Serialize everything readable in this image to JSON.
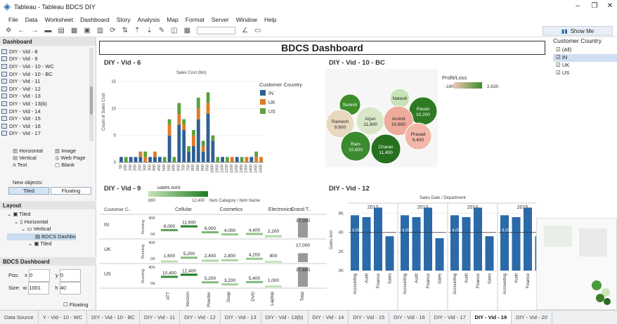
{
  "window": {
    "title": "Tableau - Tableau BDCS DIY"
  },
  "menu": [
    "File",
    "Data",
    "Worksheet",
    "Dashboard",
    "Story",
    "Analysis",
    "Map",
    "Format",
    "Server",
    "Window",
    "Help"
  ],
  "toolbar": {
    "show_me": "Show Me"
  },
  "left": {
    "dashboard_header": "Dashboard",
    "sheets": [
      "DIY - Vid - 8",
      "DIY - Vid - 9",
      "DIY - Vid - 10 - WC",
      "DIY - Vid - 10 - BC",
      "DIY - Vid - 11",
      "DIY - Vid - 12",
      "DIY - Vid - 13",
      "DIY - Vid - 13(b)",
      "DIY - Vid - 14",
      "DIY - Vid - 15",
      "DIY - Vid - 16",
      "DIY - Vid - 17"
    ],
    "objects": [
      "Horizontal",
      "Image",
      "Vertical",
      "Web Page",
      "Text",
      "Blank"
    ],
    "new_objects": "New objects:",
    "tiled": "Tiled",
    "floating": "Floating",
    "layout_header": "Layout",
    "tree": [
      "Tiled",
      "Horizontal",
      "Vertical",
      "BDCS Dashbo",
      "Tiled"
    ],
    "bdcs_header": "BDCS Dashboard",
    "pos_label": "Pos:",
    "size_label": "Size:",
    "x": "0",
    "y": "0",
    "w": "1001",
    "h": "40",
    "floating_check": "Floating"
  },
  "dashboard": {
    "title": "BDCS Dashboard",
    "sheet6": "DIY - Vid - 6",
    "sheet10": "DIY - Vid - 10 - BC",
    "sheet9": "DIY - Vid - 9",
    "sheet12": "DIY - Vid - 12"
  },
  "filter": {
    "title": "Customer Country",
    "options": [
      "(All)",
      "IN",
      "UK",
      "US"
    ]
  },
  "tabs": [
    "Data Source",
    "Y - Vid - 10 - WC",
    "DIY - Vid - 10 - BC",
    "DIY - Vid - 11",
    "DIY - Vid - 12",
    "DIY - Vid - 13",
    "DIY - Vid - 13(b)",
    "DIY - Vid - 14",
    "DIY - Vid - 15",
    "DIY - Vid - 16",
    "DIY - Vid - 17",
    "DIY - Vid - 19",
    "DIY - Vid - 20"
  ],
  "colors": {
    "IN": "#2e5f94",
    "UK": "#e07b25",
    "US": "#5aa33a",
    "green": "#2f8a2a",
    "blue": "#2a6aa8"
  },
  "chart_data": [
    {
      "type": "bar",
      "title": "Sales Cost (bin)",
      "ylabel": "Count of Sales Cost",
      "ylim": [
        0,
        15
      ],
      "categories": [
        "50",
        "100",
        "150",
        "200",
        "250",
        "300",
        "350",
        "400",
        "450",
        "500",
        "550",
        "600",
        "650",
        "700",
        "750",
        "800",
        "850",
        "900",
        "950",
        "1000",
        "1050",
        "1100",
        "1150",
        "1200",
        "1250",
        "1300",
        "1350",
        "1400",
        "1450",
        "1500"
      ],
      "series": [
        {
          "name": "IN",
          "values": [
            1,
            0,
            1,
            1,
            1,
            0,
            1,
            1,
            1,
            0,
            5,
            0,
            7,
            6,
            2,
            3,
            8,
            2,
            9,
            4,
            0,
            1,
            0,
            0,
            1,
            0,
            0,
            1,
            0,
            0
          ]
        },
        {
          "name": "UK",
          "values": [
            0,
            0,
            0,
            0,
            1,
            1,
            0,
            1,
            0,
            0,
            2,
            0,
            2,
            1,
            0,
            2,
            2,
            1,
            2,
            0,
            0,
            0,
            0,
            1,
            0,
            0,
            1,
            0,
            1,
            1
          ]
        },
        {
          "name": "US",
          "values": [
            0,
            1,
            0,
            0,
            0,
            1,
            0,
            0,
            0,
            1,
            1,
            1,
            2,
            1,
            1,
            1,
            2,
            1,
            2,
            1,
            1,
            0,
            1,
            0,
            0,
            1,
            0,
            0,
            1,
            0
          ]
        }
      ],
      "legend_title": "Customer Country"
    },
    {
      "type": "scatter",
      "title": "Profit/Loss",
      "legend_range": [
        "-180",
        "2,630"
      ],
      "bubbles": [
        {
          "name": "Suresh",
          "value": ""
        },
        {
          "name": "Naresh",
          "value": ""
        },
        {
          "name": "Pavan",
          "value": "10,200"
        },
        {
          "name": "Ramesh",
          "value": "9,600"
        },
        {
          "name": "Arjun",
          "value": "11,800"
        },
        {
          "name": "Arvind",
          "value": "10,600"
        },
        {
          "name": "Prasad",
          "value": "9,400"
        },
        {
          "name": "Ram",
          "value": "10,600"
        },
        {
          "name": "Charan",
          "value": "11,400"
        }
      ]
    },
    {
      "type": "table",
      "title": "Sales Amt",
      "legend_range": [
        "880",
        "12,400"
      ],
      "header": "Item Category / Item Name",
      "row_header": "Customer C..",
      "categories": [
        "Cellular",
        "Cosmetics",
        "Electronics",
        "Grand T.."
      ],
      "items": [
        "ATT",
        "Verizon",
        "Powder",
        "Soap",
        "DVD",
        "Laptop",
        "Total"
      ],
      "rows": [
        {
          "country": "IN",
          "values": [
            "8,000",
            "11,600",
            "6,000",
            "4,000",
            "4,400",
            "2,200",
            "37,000"
          ]
        },
        {
          "country": "UK",
          "values": [
            "1,600",
            "5,200",
            "2,400",
            "2,800",
            "4,200",
            "800",
            "17,000"
          ]
        },
        {
          "country": "US",
          "values": [
            "10,400",
            "12,400",
            "5,200",
            "3,200",
            "5,400",
            "1,000",
            "37,600"
          ]
        }
      ],
      "axis_label": "Running",
      "ticks": [
        "40K",
        "0K"
      ]
    },
    {
      "type": "bar",
      "title": "Sales Date / Department",
      "ylabel": "Sales Amt",
      "ylim": [
        0,
        7000
      ],
      "yticks": [
        "6K",
        "4K",
        "2K",
        "0K"
      ],
      "years": [
        "2012",
        "2013",
        "2014",
        "2015"
      ],
      "categories": [
        "Accounting",
        "Audit",
        "Finance",
        "Sales"
      ],
      "reference": "4,000",
      "values": [
        [
          5800,
          5600,
          6600,
          3600
        ],
        [
          5800,
          5600,
          6600,
          3400
        ],
        [
          5800,
          5600,
          6600,
          3600
        ],
        [
          5800,
          5600,
          6600,
          3600
        ]
      ]
    }
  ]
}
